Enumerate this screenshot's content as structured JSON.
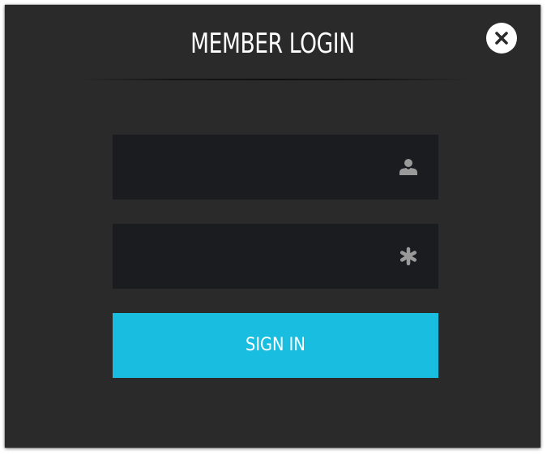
{
  "dialog": {
    "title": "MEMBER LOGIN",
    "close_icon": "close-icon"
  },
  "form": {
    "username": {
      "value": "",
      "placeholder": "",
      "icon": "user-icon"
    },
    "password": {
      "value": "",
      "placeholder": "",
      "icon": "asterisk-icon"
    },
    "signin_label": "SIGN IN"
  },
  "colors": {
    "dialog_bg": "#2a2a2a",
    "field_bg": "#1b1c20",
    "accent": "#19bde0",
    "icon_gray": "#9a9a9a"
  }
}
